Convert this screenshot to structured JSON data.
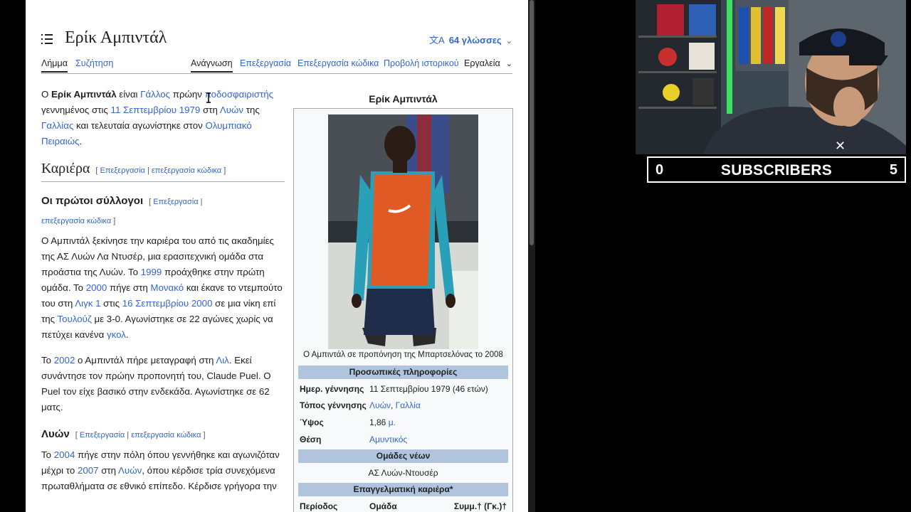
{
  "article": {
    "title": "Ερίκ Αμπιντάλ",
    "languages_label": "64 γλώσσες",
    "tabs_left": [
      "Λήμμα",
      "Συζήτηση"
    ],
    "tabs_right": [
      "Ανάγνωση",
      "Επεξεργασία",
      "Επεξεργασία κώδικα",
      "Προβολή ιστορικού",
      "Εργαλεία"
    ],
    "intro": {
      "t1": "Ο ",
      "name_bold": "Ερίκ Αμπιντάλ",
      "t2": " είναι ",
      "l1": "Γάλλος",
      "t3": " πρώην ",
      "l2": "ποδοσφαιριστής",
      "t4": " γεννημένος στις ",
      "l3": "11 Σεπτεμβρίου",
      "t5": " ",
      "l4": "1979",
      "t6": " στη ",
      "l5": "Λυών",
      "t7": " της ",
      "l6": "Γαλλίας",
      "t8": " και τελευταία αγωνίστηκε στον ",
      "l7": "Ολυμπιακό Πειραιώς",
      "t9": "."
    },
    "career_heading": "Καριέρα",
    "edit_link": "Επεξεργασία",
    "edit_code_link": "επεξεργασία κώδικα",
    "first_clubs_heading": "Οι πρώτοι σύλλογοι",
    "p1": {
      "t1": "Ο Αμπιντάλ ξεκίνησε την καριέρα του από τις ακαδημίες της ΑΣ Λυών Λα Ντυσέρ, μια ερασιτεχνική ομάδα στα προάστια της Λυών. Το ",
      "l1": "1999",
      "t2": " προάχθηκε στην πρώτη ομάδα. Το ",
      "l2": "2000",
      "t3": " πήγε στη ",
      "l3": "Μονακό",
      "t4": " και έκανε το ντεμπούτο του στη ",
      "l4": "Λιγκ 1",
      "t5": " στις ",
      "l5": "16 Σεπτεμβρίου 2000",
      "t6": " σε μια νίκη επί της ",
      "l6": "Τουλούζ",
      "t7": " με 3-0. Αγωνίστηκε σε 22 αγώνες χωρίς να πετύχει κανένα ",
      "l7": "γκολ",
      "t8": "."
    },
    "p2": {
      "t1": "Το ",
      "l1": "2002",
      "t2": " ο Αμπιντάλ πήρε μεταγραφή στη ",
      "l2": "Λιλ",
      "t3": ". Εκεί συνάντησε τον πρώην προπονητή του, Claude Puel. Ο Puel τον είχε βασικό στην ενδεκάδα. Αγωνίστηκε σε 62 ματς."
    },
    "lyon_heading": "Λυών",
    "p3": {
      "t1": "Το ",
      "l1": "2004",
      "t2": " πήγε στην πόλη όπου γεννήθηκε και αγωνιζόταν μέχρι το ",
      "l2": "2007",
      "t3": " στη ",
      "l3": "Λυών",
      "t4": ", όπου κέρδισε τρία συνεχόμενα πρωταθλήματα σε εθνικό επίπεδο. Κέρδισε γρήγορα την"
    }
  },
  "infobox": {
    "title": "Ερίκ Αμπιντάλ",
    "caption": "Ο Αμπιντάλ σε προπόνηση της Μπαρτσελόνας το 2008",
    "personal_header": "Προσωπικές πληροφορίες",
    "birth_label": "Ημερ. γέννησης",
    "birth_value": "11 Σεπτεμβρίου 1979 (46 ετών)",
    "birthplace_label": "Τόπος γέννησης",
    "birthplace_city": "Λυών",
    "birthplace_sep": ", ",
    "birthplace_country": "Γαλλία",
    "height_label": "Ύψος",
    "height_value": "1,86 ",
    "height_unit": "μ.",
    "position_label": "Θέση",
    "position_value": "Αμυντικός",
    "youth_header": "Ομάδες νέων",
    "youth_team": "ΑΣ Λυών-Ντουσέρ",
    "pro_header": "Επαγγελματική καριέρα*",
    "col_period": "Περίοδος",
    "col_team": "Ομάδα",
    "col_apps": "Συμμ.† (Γκ.)†"
  },
  "stream": {
    "sub_left": "0",
    "sub_label": "SUBSCRIBERS",
    "sub_right": "5"
  },
  "colors": {
    "link": "#3366cc",
    "infobox_header": "#b0c4de",
    "text": "#202122"
  }
}
